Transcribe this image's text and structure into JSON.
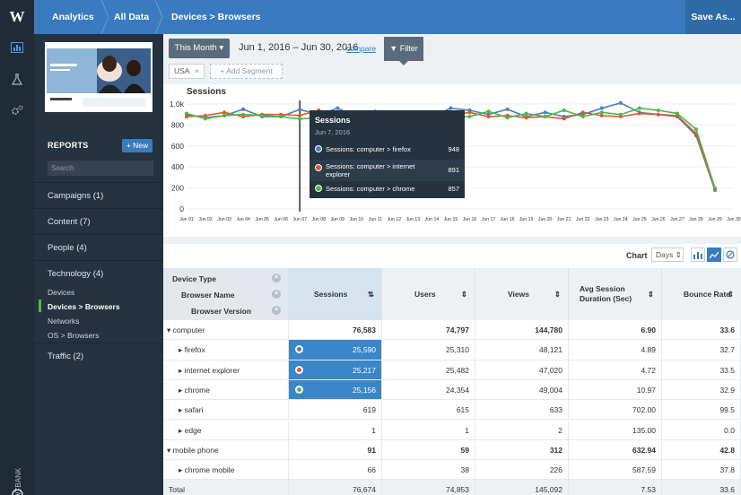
{
  "topbar": {
    "logo": "W",
    "crumbs": [
      "Analytics",
      "All Data",
      "Devices > Browsers"
    ],
    "save_as": "Save As..."
  },
  "leftnav": {
    "icons": [
      "bar-chart-icon",
      "flask-icon",
      "gears-icon",
      "info-icon"
    ],
    "brand_vertical": "WTBANK"
  },
  "sidebar": {
    "reports_label": "REPORTS",
    "new_label": "+ New",
    "search_placeholder": "Search",
    "items": [
      {
        "label": "Campaigns",
        "count": "(1)"
      },
      {
        "label": "Content",
        "count": "(7)"
      },
      {
        "label": "People",
        "count": "(4)"
      },
      {
        "label": "Technology",
        "count": "(4)"
      }
    ],
    "subitems": [
      "Devices",
      "Devices > Browsers",
      "Networks",
      "OS > Browsers"
    ],
    "traffic": {
      "label": "Traffic",
      "count": "(2)"
    }
  },
  "controls": {
    "month_label": "This Month ▾",
    "date_range": "Jun 1, 2016 – Jun 30, 2016",
    "compare_label": "compare",
    "filter_label": "Filter",
    "segment_tag": "USA",
    "segment_x": "×",
    "add_segment": "+ Add Segment"
  },
  "chart_data": {
    "type": "line",
    "title": "Sessions",
    "x": [
      "Jun 01",
      "Jun 02",
      "Jun 03",
      "Jun 04",
      "Jun 05",
      "Jun 06",
      "Jun 07",
      "Jun 08",
      "Jun 09",
      "Jun 10",
      "Jun 11",
      "Jun 12",
      "Jun 13",
      "Jun 14",
      "Jun 15",
      "Jun 16",
      "Jun 17",
      "Jun 18",
      "Jun 19",
      "Jun 20",
      "Jun 21",
      "Jun 22",
      "Jun 23",
      "Jun 24",
      "Jun 25",
      "Jun 26",
      "Jun 27",
      "Jun 28",
      "Jun 29",
      "Jun 30"
    ],
    "ytick_labels": [
      "0",
      "200",
      "400",
      "600",
      "800",
      "1.0k"
    ],
    "ylim": [
      0,
      1000
    ],
    "series": [
      {
        "name": "Sessions: computer > firefox",
        "color": "#4a7fc1",
        "values": [
          900,
          870,
          890,
          950,
          880,
          880,
          948,
          900,
          960,
          880,
          930,
          900,
          890,
          880,
          960,
          940,
          900,
          950,
          880,
          920,
          880,
          900,
          960,
          1010,
          920,
          900,
          880,
          700,
          180,
          null
        ]
      },
      {
        "name": "Sessions: computer > internet explorer",
        "color": "#e2582d",
        "values": [
          880,
          890,
          920,
          880,
          900,
          900,
          891,
          940,
          880,
          870,
          900,
          880,
          890,
          870,
          890,
          920,
          880,
          890,
          870,
          880,
          860,
          920,
          890,
          880,
          910,
          900,
          890,
          720,
          190,
          null
        ]
      },
      {
        "name": "Sessions: computer > chrome",
        "color": "#4cb748",
        "values": [
          910,
          860,
          890,
          900,
          890,
          880,
          857,
          870,
          900,
          920,
          880,
          900,
          870,
          900,
          880,
          880,
          930,
          870,
          910,
          880,
          940,
          880,
          920,
          900,
          960,
          940,
          910,
          760,
          200,
          null
        ]
      }
    ]
  },
  "tooltip": {
    "title": "Sessions",
    "date": "Jun 7, 2016",
    "rows": [
      {
        "label": "Sessions: computer > firefox",
        "value": "948",
        "color": "#4a7fc1"
      },
      {
        "label": "Sessions: computer > internet explorer",
        "value": "891",
        "color": "#e2582d"
      },
      {
        "label": "Sessions: computer > chrome",
        "value": "857",
        "color": "#4cb748"
      }
    ]
  },
  "table_controls": {
    "chart_label": "Chart",
    "days_label": "Days ⇕"
  },
  "table": {
    "dimensions": [
      "Device Type",
      "Browser Name",
      "Browser Version"
    ],
    "columns": [
      "Sessions",
      "Users",
      "Views",
      "Avg Session Duration (Sec)",
      "Bounce Rate"
    ],
    "sort_icons": [
      "⇅",
      "⇕",
      "⇕",
      "⇕",
      "⇕"
    ],
    "rows": [
      {
        "name": "▾ computer",
        "level": 0,
        "values": [
          "76,583",
          "74,797",
          "144,780",
          "6.90",
          "33.6"
        ]
      },
      {
        "name": "▸ firefox",
        "level": 1,
        "values": [
          "25,590",
          "25,310",
          "48,121",
          "4.89",
          "32.7"
        ],
        "dot": "#4a7fc1"
      },
      {
        "name": "▸ internet explorer",
        "level": 1,
        "values": [
          "25,217",
          "25,482",
          "47,020",
          "4.72",
          "33.5"
        ],
        "dot": "#e2582d"
      },
      {
        "name": "▸ chrome",
        "level": 1,
        "values": [
          "25,156",
          "24,354",
          "49,004",
          "10.97",
          "32.9"
        ],
        "dot": "#4cb748"
      },
      {
        "name": "▸ safari",
        "level": 1,
        "values": [
          "619",
          "615",
          "633",
          "702.00",
          "99.5"
        ]
      },
      {
        "name": "▸ edge",
        "level": 1,
        "values": [
          "1",
          "1",
          "2",
          "135.00",
          "0.0"
        ]
      },
      {
        "name": "▾ mobile phone",
        "level": 0,
        "values": [
          "91",
          "59",
          "312",
          "632.94",
          "42.8"
        ]
      },
      {
        "name": "▸ chrome mobile",
        "level": 1,
        "values": [
          "66",
          "38",
          "226",
          "587.59",
          "37.8"
        ]
      },
      {
        "name": "Total",
        "level": 0,
        "values": [
          "76,674",
          "74,853",
          "145,092",
          "7.53",
          "33.6"
        ]
      }
    ]
  }
}
